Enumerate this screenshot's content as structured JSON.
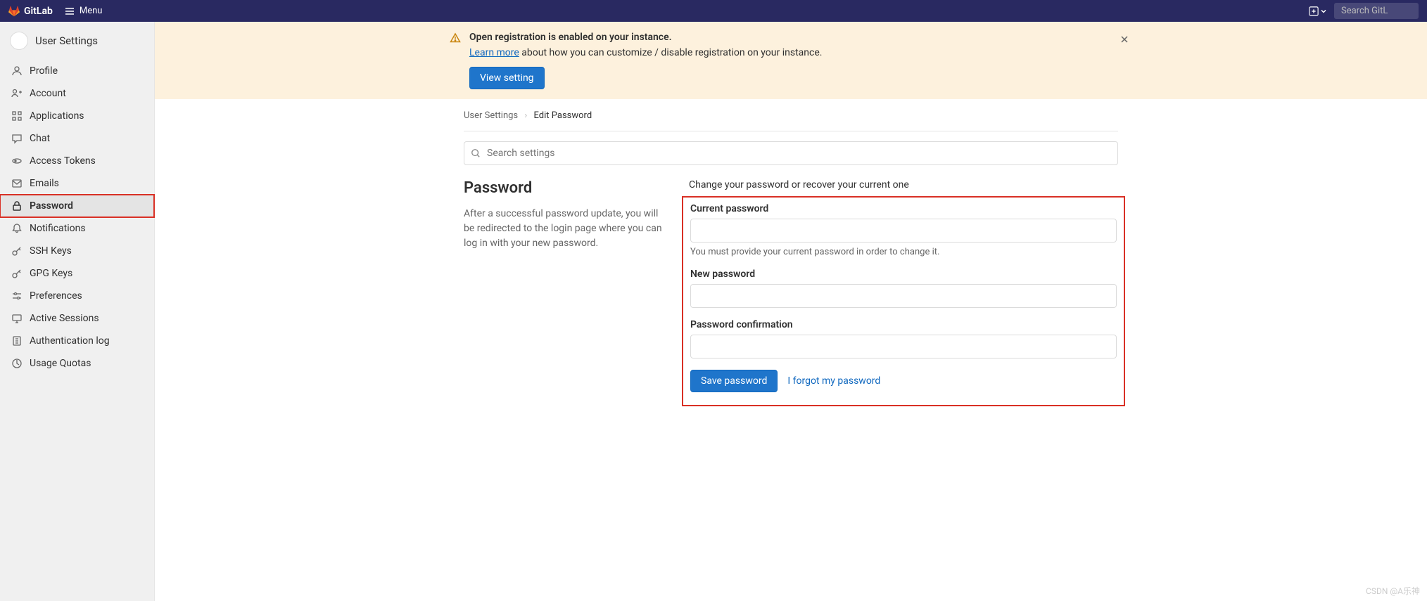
{
  "topbar": {
    "brand": "GitLab",
    "menu_label": "Menu",
    "search_placeholder": "Search GitL"
  },
  "sidebar": {
    "title": "User Settings",
    "items": [
      {
        "key": "profile",
        "label": "Profile"
      },
      {
        "key": "account",
        "label": "Account"
      },
      {
        "key": "applications",
        "label": "Applications"
      },
      {
        "key": "chat",
        "label": "Chat"
      },
      {
        "key": "access-tokens",
        "label": "Access Tokens"
      },
      {
        "key": "emails",
        "label": "Emails"
      },
      {
        "key": "password",
        "label": "Password"
      },
      {
        "key": "notifications",
        "label": "Notifications"
      },
      {
        "key": "ssh-keys",
        "label": "SSH Keys"
      },
      {
        "key": "gpg-keys",
        "label": "GPG Keys"
      },
      {
        "key": "preferences",
        "label": "Preferences"
      },
      {
        "key": "active-sessions",
        "label": "Active Sessions"
      },
      {
        "key": "authentication-log",
        "label": "Authentication log"
      },
      {
        "key": "usage-quotas",
        "label": "Usage Quotas"
      }
    ]
  },
  "alert": {
    "title": "Open registration is enabled on your instance.",
    "learn_more": "Learn more",
    "desc_rest": " about how you can customize / disable registration on your instance.",
    "button": "View setting"
  },
  "breadcrumb": {
    "root": "User Settings",
    "current": "Edit Password"
  },
  "search_settings": {
    "placeholder": "Search settings"
  },
  "password_section": {
    "heading": "Password",
    "left_desc": "After a successful password update, you will be redirected to the login page where you can log in with your new password.",
    "right_desc": "Change your password or recover your current one",
    "current_label": "Current password",
    "current_help": "You must provide your current password in order to change it.",
    "new_label": "New password",
    "confirm_label": "Password confirmation",
    "save_button": "Save password",
    "forgot_link": "I forgot my password"
  },
  "watermark": "CSDN @A乐神"
}
